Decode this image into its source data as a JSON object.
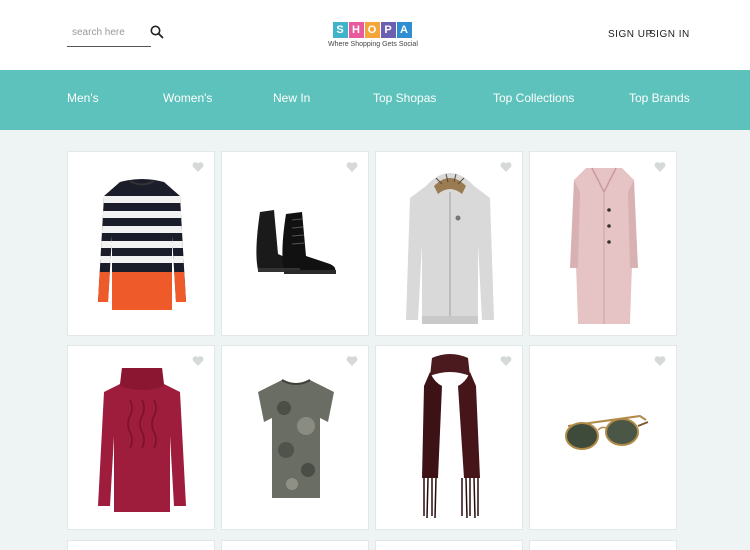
{
  "header": {
    "search_placeholder": "search here",
    "logo_letters": [
      "S",
      "H",
      "O",
      "P",
      "A"
    ],
    "logo_colors": [
      "#3fb3c9",
      "#e85a9d",
      "#f4a63a",
      "#6c5fb1",
      "#2f8ed1"
    ],
    "tagline": "Where Shopping Gets Social",
    "sign_up": "SIGN UP",
    "sign_in": "SIGN IN"
  },
  "nav": {
    "items": [
      "Men's",
      "Women's",
      "New In",
      "Top Shopas",
      "Top Collections",
      "Top Brands"
    ]
  },
  "colors": {
    "accent": "#5cc2bb",
    "heart": "#d5d9d9",
    "background": "#eef3f3"
  },
  "products": [
    {
      "name": "striped-sweater"
    },
    {
      "name": "leather-boots"
    },
    {
      "name": "grey-hoodie"
    },
    {
      "name": "pink-coat"
    },
    {
      "name": "red-cable-knit-sweater"
    },
    {
      "name": "camo-tshirt"
    },
    {
      "name": "maroon-scarf"
    },
    {
      "name": "aviator-sunglasses"
    }
  ]
}
